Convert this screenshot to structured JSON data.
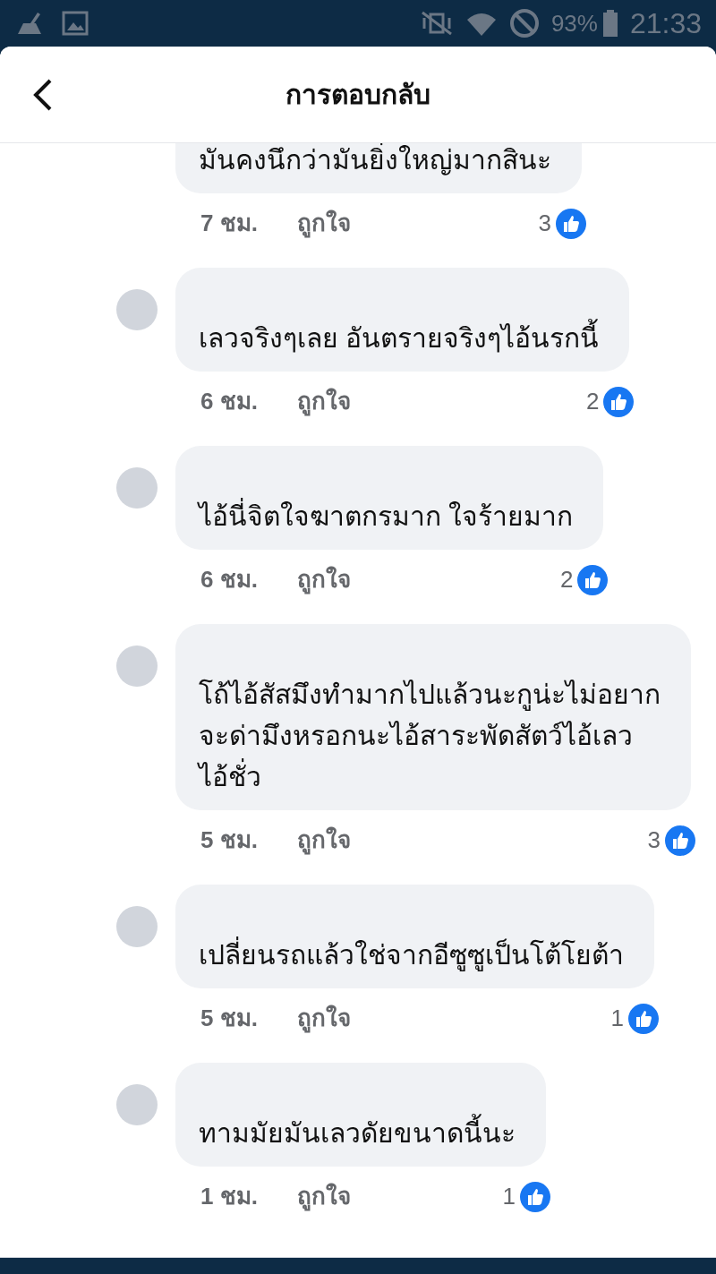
{
  "status_bar": {
    "battery": "93%",
    "time": "21:33"
  },
  "header": {
    "title": "การตอบกลับ"
  },
  "comments": [
    {
      "text": "มันคงนึกว่ามันยิ่งใหญ่มากสินะ",
      "time": "7 ชม.",
      "like_label": "ถูกใจ",
      "likes": "3"
    },
    {
      "text": "เลวจริงๆเลย อันตรายจริงๆไอ้นรกนี้",
      "time": "6 ชม.",
      "like_label": "ถูกใจ",
      "likes": "2"
    },
    {
      "text": "ไอ้นี่จิตใจฆาตกรมาก ใจร้ายมาก",
      "time": "6 ชม.",
      "like_label": "ถูกใจ",
      "likes": "2"
    },
    {
      "text": "โถ้ไอ้สัสมึงทำมากไปแล้วนะกูน่ะไม่อยากจะด่ามึงหรอกนะไอ้สาระพัดสัตว์ไอ้เลวไอ้ชั่ว",
      "time": "5 ชม.",
      "like_label": "ถูกใจ",
      "likes": "3"
    },
    {
      "text": "เปลี่ยนรถแล้วใช่จากอีซูซูเป็นโต้โยต้า",
      "time": "5 ชม.",
      "like_label": "ถูกใจ",
      "likes": "1"
    },
    {
      "text": "ทามมัยมันเลวดัยขนาดนี้นะ",
      "time": "1 ชม.",
      "like_label": "ถูกใจ",
      "likes": "1"
    }
  ]
}
